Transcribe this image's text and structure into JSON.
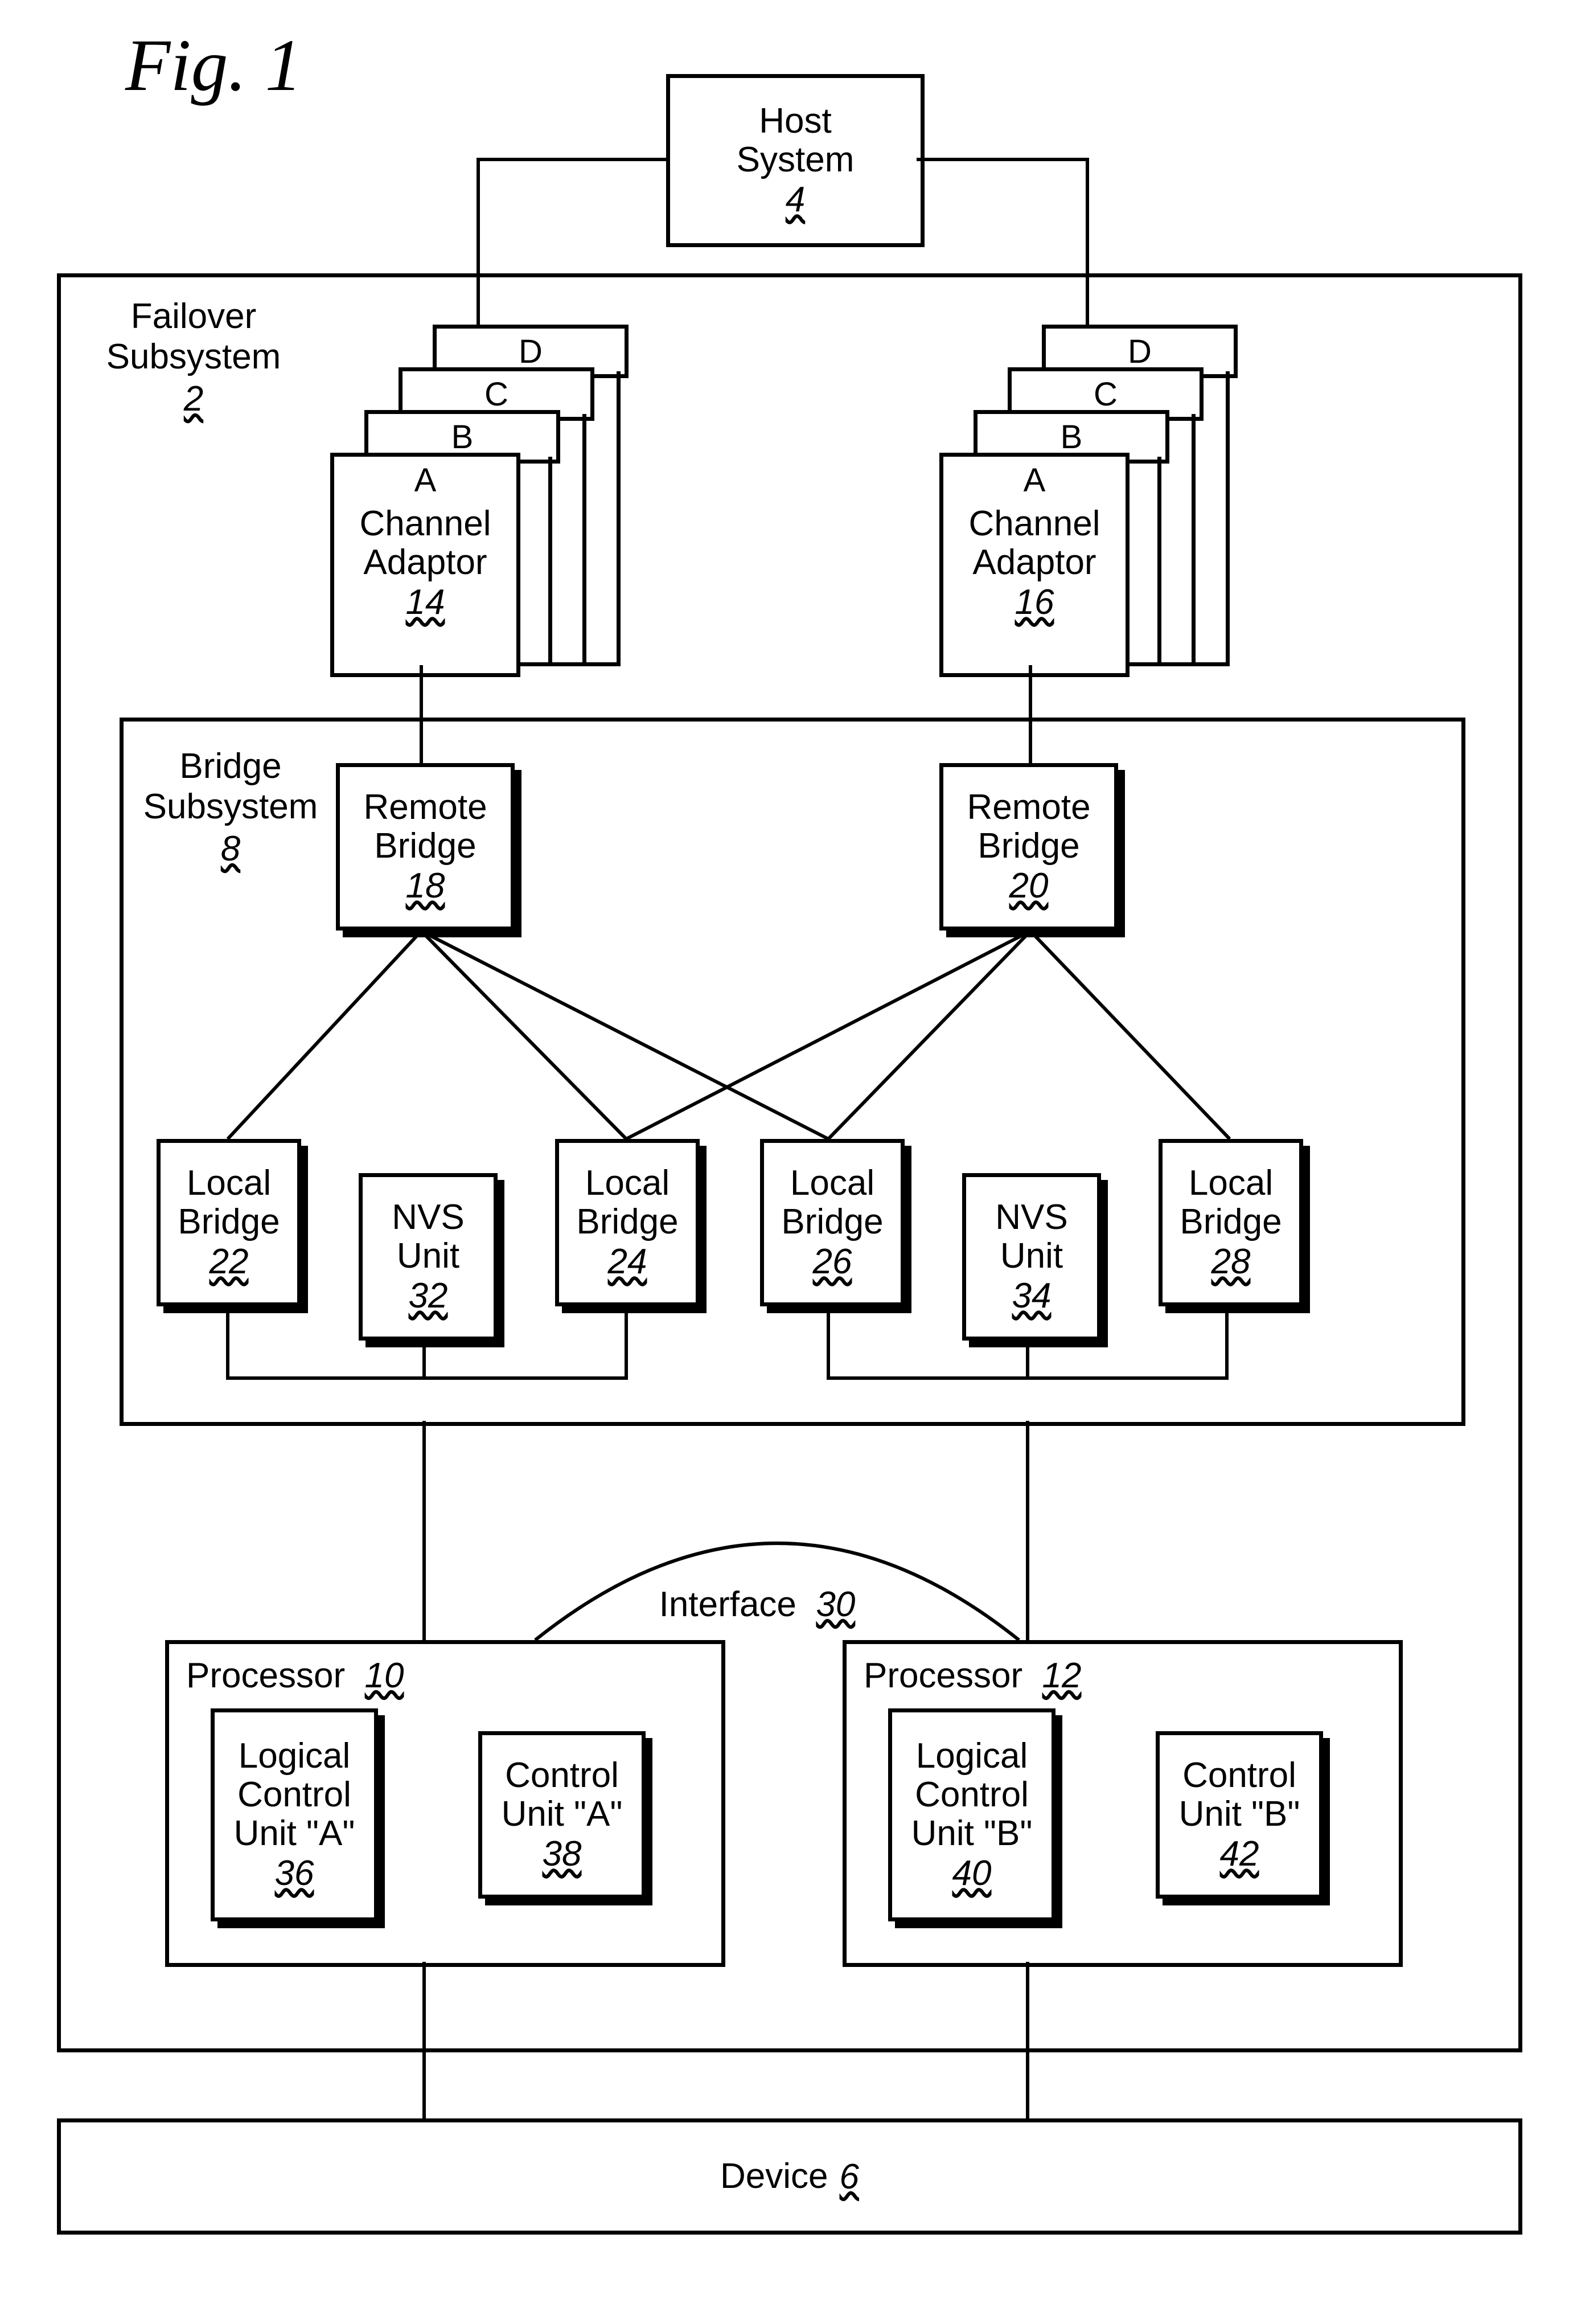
{
  "figure_label": "Fig. 1",
  "host": {
    "title_l1": "Host",
    "title_l2": "System",
    "ref": "4"
  },
  "failover": {
    "title_l1": "Failover",
    "title_l2": "Subsystem",
    "ref": "2"
  },
  "adapter_tabs": [
    "D",
    "C",
    "B",
    "A"
  ],
  "adapter_left": {
    "title_l1": "Channel",
    "title_l2": "Adaptor",
    "ref": "14"
  },
  "adapter_right": {
    "title_l1": "Channel",
    "title_l2": "Adaptor",
    "ref": "16"
  },
  "bridge_sub": {
    "title_l1": "Bridge",
    "title_l2": "Subsystem",
    "ref": "8"
  },
  "remote_left": {
    "title_l1": "Remote",
    "title_l2": "Bridge",
    "ref": "18"
  },
  "remote_right": {
    "title_l1": "Remote",
    "title_l2": "Bridge",
    "ref": "20"
  },
  "local_22": {
    "title_l1": "Local",
    "title_l2": "Bridge",
    "ref": "22"
  },
  "local_24": {
    "title_l1": "Local",
    "title_l2": "Bridge",
    "ref": "24"
  },
  "local_26": {
    "title_l1": "Local",
    "title_l2": "Bridge",
    "ref": "26"
  },
  "local_28": {
    "title_l1": "Local",
    "title_l2": "Bridge",
    "ref": "28"
  },
  "nvs_32": {
    "title_l1": "NVS",
    "title_l2": "Unit",
    "ref": "32"
  },
  "nvs_34": {
    "title_l1": "NVS",
    "title_l2": "Unit",
    "ref": "34"
  },
  "interface": {
    "title": "Interface",
    "ref": "30"
  },
  "proc_left": {
    "title": "Processor",
    "ref": "10"
  },
  "proc_right": {
    "title": "Processor",
    "ref": "12"
  },
  "lcu_a": {
    "l1": "Logical",
    "l2": "Control",
    "l3": "Unit \"A\"",
    "ref": "36"
  },
  "cu_a": {
    "l1": "Control",
    "l2": "Unit \"A\"",
    "ref": "38"
  },
  "lcu_b": {
    "l1": "Logical",
    "l2": "Control",
    "l3": "Unit \"B\"",
    "ref": "40"
  },
  "cu_b": {
    "l1": "Control",
    "l2": "Unit \"B\"",
    "ref": "42"
  },
  "device": {
    "title": "Device",
    "ref": "6"
  }
}
